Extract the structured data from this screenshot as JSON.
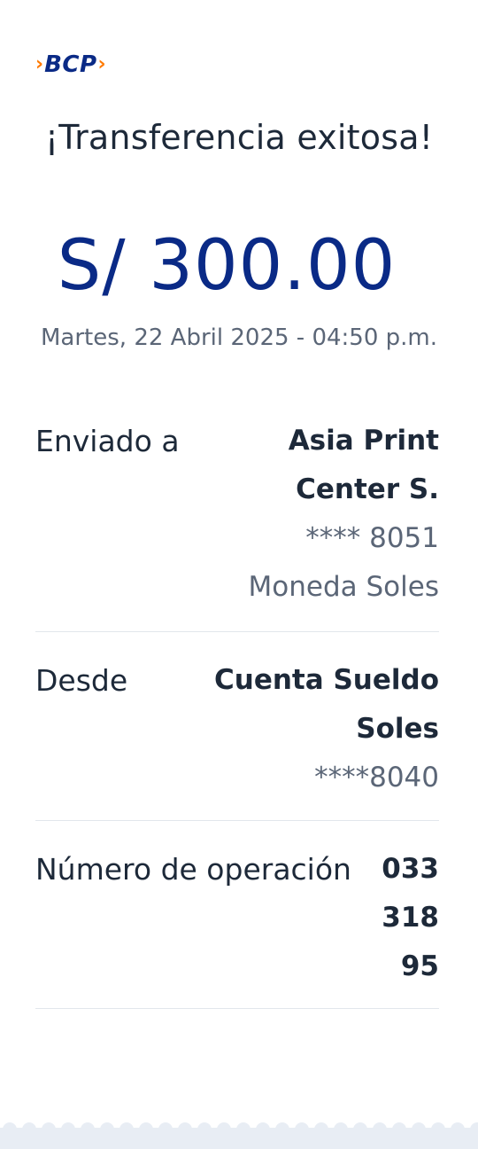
{
  "brand": {
    "name": "BCP",
    "left_chevron": "›",
    "right_chevron": "›",
    "chevron_color": "#ff7a00",
    "name_color": "#0a2a86"
  },
  "title": "¡Transferencia exitosa!",
  "amount": "S/ 300.00",
  "date": "Martes, 22 Abril 2025 - 04:50 p.m.",
  "details": {
    "recipient": {
      "label": "Enviado a",
      "name_line1": "Asia Print",
      "name_line2": "Center S.",
      "account": "**** 8051",
      "currency": "Moneda Soles"
    },
    "source": {
      "label": "Desde",
      "account_line1": "Cuenta Sueldo",
      "account_line2": "Soles",
      "account_number": "****8040"
    },
    "operation": {
      "label": "Número de operación",
      "number_line1": "033",
      "number_line2": "318",
      "number_line3": "95"
    }
  },
  "colors": {
    "accent_blue": "#0a2a86",
    "text_dark": "#1d2939",
    "text_muted": "#5b6677",
    "footer_band": "#e8edf4"
  }
}
